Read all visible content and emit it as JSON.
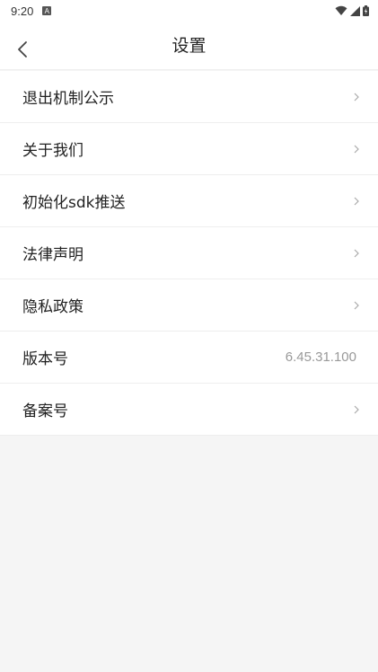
{
  "status_bar": {
    "time": "9:20",
    "notification_letter": "A"
  },
  "header": {
    "title": "设置"
  },
  "settings": {
    "items": [
      {
        "label": "退出机制公示",
        "value": ""
      },
      {
        "label": "关于我们",
        "value": ""
      },
      {
        "label": "初始化sdk推送",
        "value": ""
      },
      {
        "label": "法律声明",
        "value": ""
      },
      {
        "label": "隐私政策",
        "value": ""
      },
      {
        "label": "版本号",
        "value": "6.45.31.100"
      },
      {
        "label": "备案号",
        "value": ""
      }
    ]
  },
  "colors": {
    "background": "#f5f5f5",
    "surface": "#ffffff",
    "divider": "#eeeeee",
    "text": "#222222",
    "muted_text": "#999999"
  }
}
